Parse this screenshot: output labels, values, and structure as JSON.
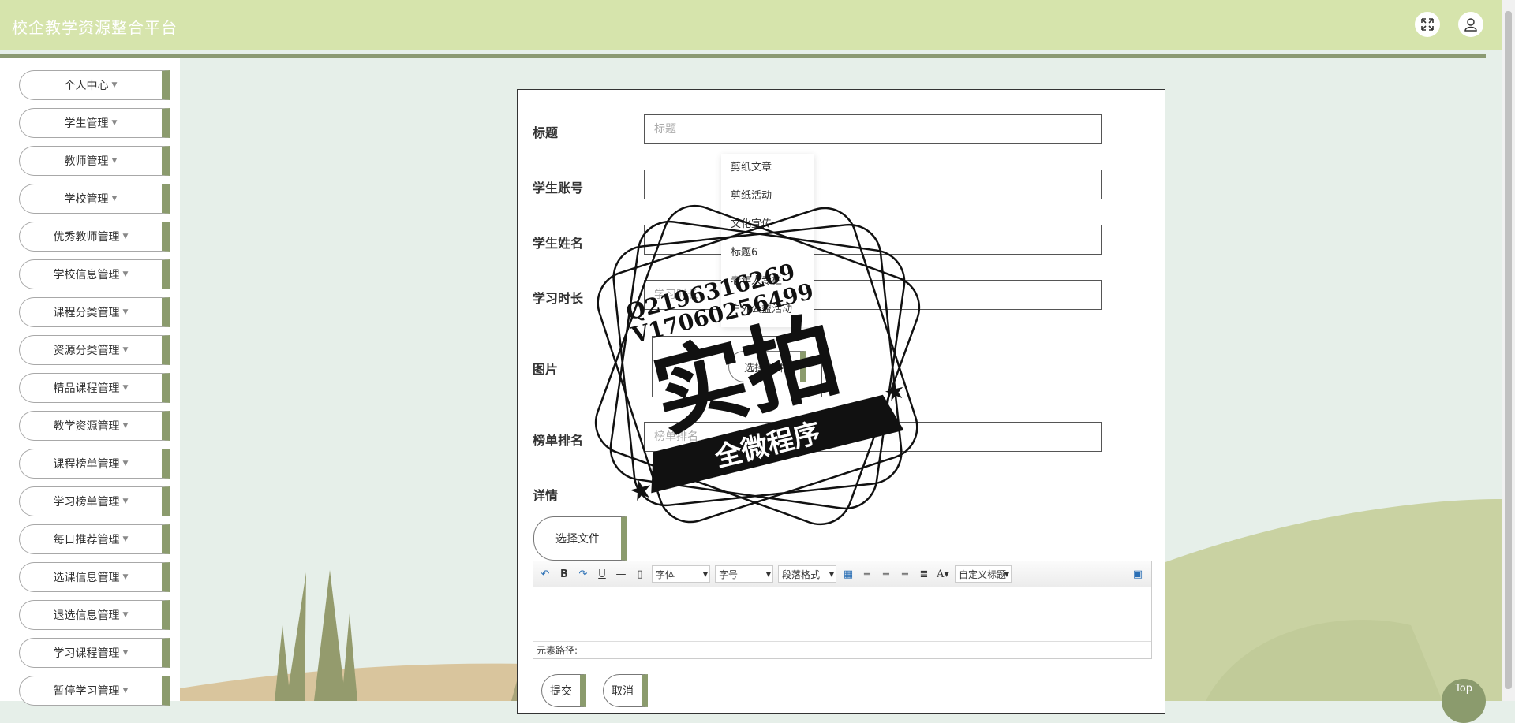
{
  "header": {
    "title": "校企教学资源整合平台",
    "fullscreen_icon": "fullscreen-icon",
    "user_icon": "user-icon",
    "bg_color": "#d6e4ac"
  },
  "sidebar": {
    "items": [
      {
        "label": "个人中心"
      },
      {
        "label": "学生管理"
      },
      {
        "label": "教师管理"
      },
      {
        "label": "学校管理"
      },
      {
        "label": "优秀教师管理"
      },
      {
        "label": "学校信息管理"
      },
      {
        "label": "课程分类管理"
      },
      {
        "label": "资源分类管理"
      },
      {
        "label": "精品课程管理"
      },
      {
        "label": "教学资源管理"
      },
      {
        "label": "课程榜单管理"
      },
      {
        "label": "学习榜单管理"
      },
      {
        "label": "每日推荐管理"
      },
      {
        "label": "选课信息管理"
      },
      {
        "label": "退选信息管理"
      },
      {
        "label": "学习课程管理"
      },
      {
        "label": "暂停学习管理"
      }
    ],
    "accent_color": "#8b9b6d"
  },
  "form": {
    "title_label": "标题",
    "title_placeholder": "标题",
    "account_label": "学生账号",
    "name_label": "学生姓名",
    "duration_label": "学习时长",
    "duration_placeholder": "学习时长",
    "image_label": "图片",
    "image_choose_label": "选择文件",
    "rank_label": "榜单排名",
    "rank_placeholder": "榜单排名",
    "detail_label": "详情",
    "detail_choose_label": "选择文件",
    "submit_label": "提交",
    "cancel_label": "取消"
  },
  "dropdown": {
    "items": [
      "剪纸文章",
      "剪纸活动",
      "文化宣传",
      "标题6",
      "老年人专栏",
      "户外公益活动"
    ]
  },
  "editor": {
    "font_select": "字体",
    "size_select": "字号",
    "paragraph_select": "段落格式",
    "custom_title_select": "自定义标题",
    "status_text": "元素路径:"
  },
  "watermark": {
    "contact_line1": "Q2196316269",
    "contact_line2": "V17060256499",
    "main_text": "实拍",
    "ribbon_text": "全微程序"
  },
  "top_button_label": "Top"
}
